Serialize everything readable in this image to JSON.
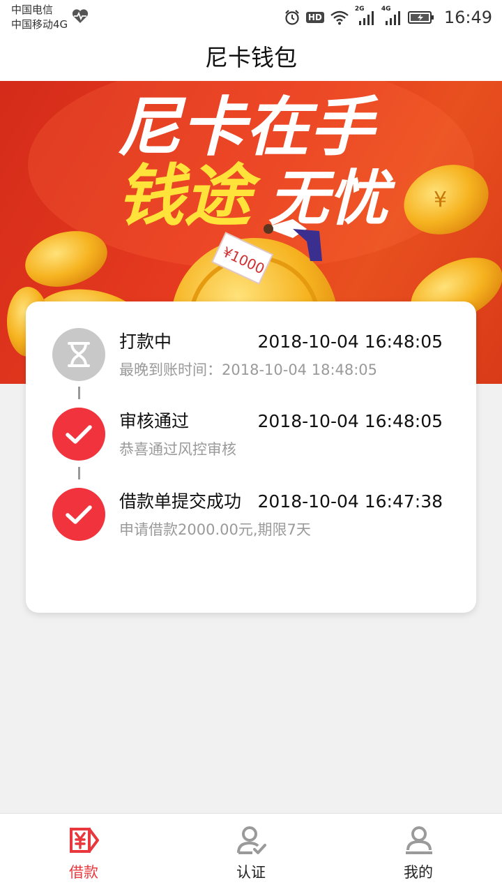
{
  "status_bar": {
    "carrier_1": "中国电信",
    "carrier_2": "中国移动4G",
    "hd_badge": "HD",
    "net_2g": "2G",
    "net_4g": "4G",
    "time": "16:49"
  },
  "header": {
    "title": "尼卡钱包"
  },
  "banner": {
    "line1": "尼卡在手",
    "line2_yellow": "钱途",
    "line2_white": "无忧",
    "note_label": "¥1000"
  },
  "timeline": [
    {
      "title": "打款中",
      "time": "2018-10-04 16:48:05",
      "subtitle": "最晚到账时间：2018-10-04 18:48:05",
      "status": "pending",
      "icon": "hourglass-icon",
      "color": "#c8c8c8"
    },
    {
      "title": "审核通过",
      "time": "2018-10-04 16:48:05",
      "subtitle": "恭喜通过风控审核",
      "status": "done",
      "icon": "check-icon",
      "color": "#f0333c"
    },
    {
      "title": "借款单提交成功",
      "time": "2018-10-04 16:47:38",
      "subtitle": "申请借款2000.00元,期限7天",
      "status": "done",
      "icon": "check-icon",
      "color": "#f0333c"
    }
  ],
  "tabs": [
    {
      "label": "借款",
      "icon": "loan-yen-icon",
      "active": true
    },
    {
      "label": "认证",
      "icon": "user-verified-icon",
      "active": false
    },
    {
      "label": "我的",
      "icon": "profile-icon",
      "active": false
    }
  ],
  "colors": {
    "accent": "#e8383d",
    "banner": "#e03a1e",
    "coin": "#f7b928"
  }
}
